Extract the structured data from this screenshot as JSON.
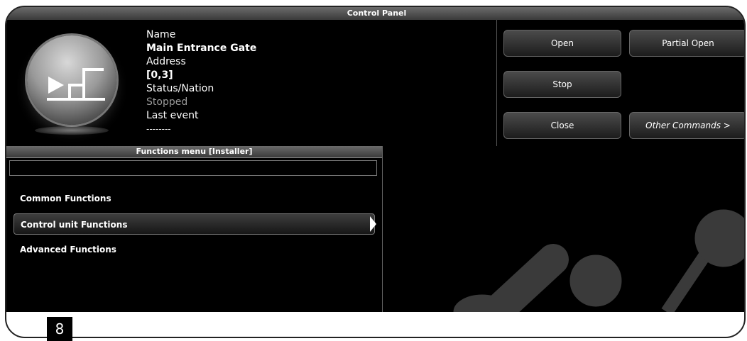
{
  "window": {
    "title": "Control Panel"
  },
  "device": {
    "labels": {
      "name": "Name",
      "address": "Address",
      "status": "Status/Nation",
      "last_event": "Last event"
    },
    "values": {
      "name": "Main Entrance Gate",
      "address": "[0,3]",
      "status": "Stopped",
      "last_event": "--------"
    },
    "icon": "gate-play-steps-icon"
  },
  "commands": {
    "open": "Open",
    "partial_open": "Partial Open",
    "stop": "Stop",
    "close": "Close",
    "other": "Other Commands >"
  },
  "functions_menu": {
    "title": "Functions menu [Installer]",
    "search_value": "",
    "items": [
      {
        "label": "Common Functions",
        "selected": false
      },
      {
        "label": "Control unit Functions",
        "selected": true
      },
      {
        "label": "Advanced Functions",
        "selected": false
      }
    ]
  },
  "page_number": "8",
  "colors": {
    "screen_bg": "#000000",
    "titlebar": "#4a4a4a",
    "text": "#ffffff",
    "dim_text": "#9a9a9a",
    "watermark": "#dcdcdc"
  }
}
